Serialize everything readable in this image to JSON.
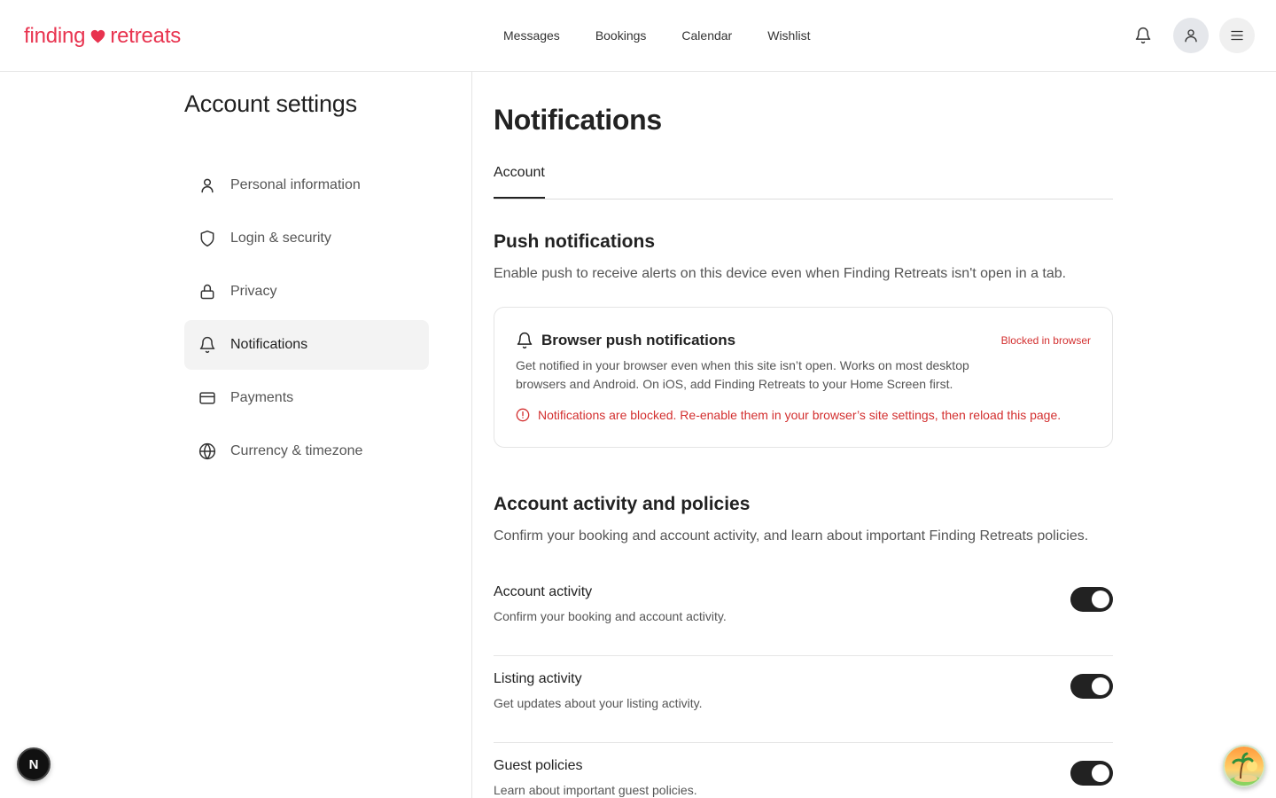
{
  "header": {
    "logo_left": "finding",
    "logo_right": "retreats",
    "nav": [
      "Messages",
      "Bookings",
      "Calendar",
      "Wishlist"
    ],
    "icons": {
      "bell": "bell-icon",
      "user": "user-icon",
      "menu": "menu-icon"
    }
  },
  "sidebar": {
    "title": "Account settings",
    "items": [
      {
        "label": "Personal information",
        "icon": "person-icon"
      },
      {
        "label": "Login & security",
        "icon": "shield-icon"
      },
      {
        "label": "Privacy",
        "icon": "lock-icon"
      },
      {
        "label": "Notifications",
        "icon": "bell-icon",
        "active": true
      },
      {
        "label": "Payments",
        "icon": "credit-card-icon"
      },
      {
        "label": "Currency & timezone",
        "icon": "globe-icon"
      }
    ]
  },
  "main": {
    "title": "Notifications",
    "tabs": [
      "Account"
    ],
    "push": {
      "title": "Push notifications",
      "description": "Enable push to receive alerts on this device even when Finding Retreats isn't open in a tab.",
      "card": {
        "title": "Browser push notifications",
        "status": "Blocked in browser",
        "description": "Get notified in your browser even when this site isn’t open. Works on most desktop browsers and Android. On iOS, add Finding Retreats to your Home Screen first.",
        "warning": "Notifications are blocked. Re-enable them in your browser’s site settings, then reload this page."
      }
    },
    "activity": {
      "title": "Account activity and policies",
      "description": "Confirm your booking and account activity, and learn about important Finding Retreats policies.",
      "settings": [
        {
          "name": "Account activity",
          "description": "Confirm your booking and account activity.",
          "enabled": true
        },
        {
          "name": "Listing activity",
          "description": "Get updates about your listing activity.",
          "enabled": true
        },
        {
          "name": "Guest policies",
          "description": "Learn about important guest policies.",
          "enabled": true
        }
      ]
    }
  },
  "floating": {
    "dev_badge": "N"
  },
  "colors": {
    "brand": "#e8334f",
    "error": "#d32f2f",
    "toggle_on": "#222222"
  }
}
